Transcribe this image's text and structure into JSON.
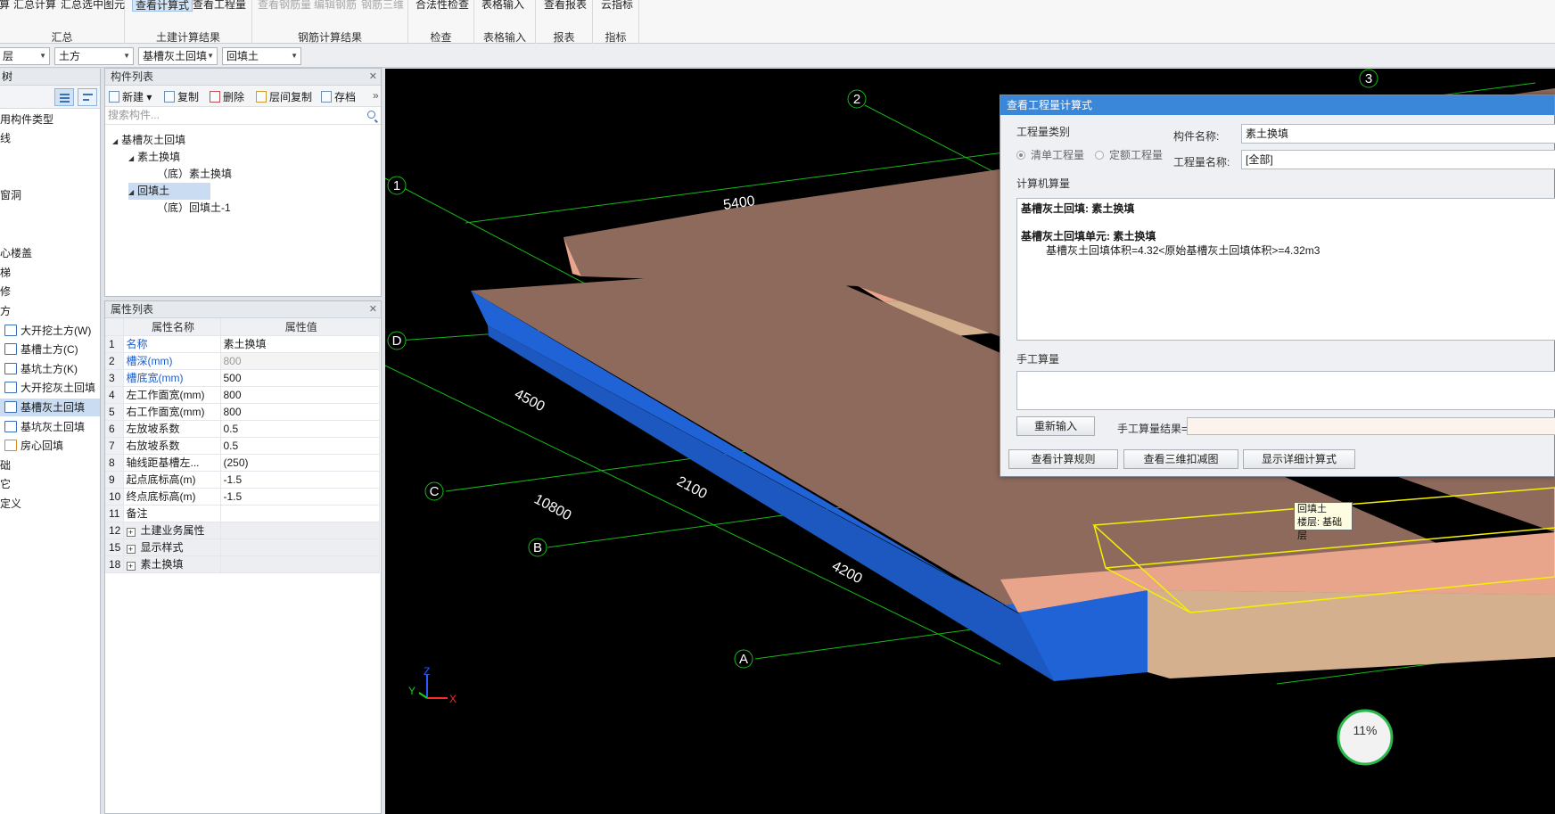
{
  "ribbon": {
    "groups": [
      {
        "label": "汇总",
        "buttons": [
          "算",
          "汇总计算",
          "汇总选中图元"
        ]
      },
      {
        "label": "土建计算结果",
        "buttons": [
          "查看计算式",
          "查看工程量"
        ]
      },
      {
        "label": "钢筋计算结果",
        "buttons": [
          "查看钢筋量",
          "编辑钢筋",
          "钢筋三维"
        ]
      },
      {
        "label": "检查",
        "buttons": [
          "合法性检查"
        ]
      },
      {
        "label": "表格输入",
        "buttons": [
          "表格输入"
        ]
      },
      {
        "label": "报表",
        "buttons": [
          "查看报表"
        ]
      },
      {
        "label": "指标",
        "buttons": [
          "云指标"
        ]
      }
    ]
  },
  "filters": {
    "floor": "层",
    "category": "土方",
    "type": "基槽灰土回填",
    "component": "回填土"
  },
  "leftnav": {
    "header": "树",
    "items": [
      "用构件类型",
      "线",
      "窗洞",
      "心楼盖",
      "梯",
      "修",
      "方",
      "大开挖土方(W)",
      "基槽土方(C)",
      "基坑土方(K)",
      "大开挖灰土回填",
      "基槽灰土回填",
      "基坑灰土回填",
      "房心回填",
      "础",
      "它",
      "定义"
    ]
  },
  "component_list": {
    "title": "构件列表",
    "toolbar": [
      "新建",
      "复制",
      "删除",
      "层间复制",
      "存档"
    ],
    "search_placeholder": "搜索构件...",
    "tree": [
      {
        "label": "基槽灰土回填",
        "level": 0
      },
      {
        "label": "素土换填",
        "level": 1
      },
      {
        "label": "（底）素土换填",
        "level": 2
      },
      {
        "label": "回填土",
        "level": 1
      },
      {
        "label": "（底）回填土-1",
        "level": 2
      }
    ]
  },
  "properties": {
    "title": "属性列表",
    "col_name": "属性名称",
    "col_value": "属性值",
    "rows": [
      {
        "n": "1",
        "name": "名称",
        "value": "素土换填",
        "blue": true
      },
      {
        "n": "2",
        "name": "槽深(mm)",
        "value": "800",
        "blue": true,
        "grey": true
      },
      {
        "n": "3",
        "name": "槽底宽(mm)",
        "value": "500",
        "blue": true
      },
      {
        "n": "4",
        "name": "左工作面宽(mm)",
        "value": "800"
      },
      {
        "n": "5",
        "name": "右工作面宽(mm)",
        "value": "800"
      },
      {
        "n": "6",
        "name": "左放坡系数",
        "value": "0.5"
      },
      {
        "n": "7",
        "name": "右放坡系数",
        "value": "0.5"
      },
      {
        "n": "8",
        "name": "轴线距基槽左...",
        "value": "(250)"
      },
      {
        "n": "9",
        "name": "起点底标高(m)",
        "value": "-1.5"
      },
      {
        "n": "10",
        "name": "终点底标高(m)",
        "value": "-1.5"
      },
      {
        "n": "11",
        "name": "备注",
        "value": ""
      },
      {
        "n": "12",
        "name": "土建业务属性",
        "value": "",
        "group": true
      },
      {
        "n": "15",
        "name": "显示样式",
        "value": "",
        "group": true
      },
      {
        "n": "18",
        "name": "素土换填",
        "value": "",
        "group": true
      }
    ]
  },
  "viewport": {
    "axes": [
      "1",
      "2",
      "3",
      "A",
      "B",
      "C",
      "D"
    ],
    "dims": [
      "5400",
      "4500",
      "2100",
      "10800",
      "4200"
    ],
    "tooltip_line1": "回填土",
    "tooltip_line2": "楼层: 基础层",
    "zoom": "11%",
    "axis_labels": {
      "x": "X",
      "y": "Y",
      "z": "Z"
    }
  },
  "dialog": {
    "title": "查看工程量计算式",
    "qty_category_label": "工程量类别",
    "radio_list": "清单工程量",
    "radio_quota": "定额工程量",
    "comp_name_label": "构件名称:",
    "comp_name_value": "素土换填",
    "qty_name_label": "工程量名称:",
    "qty_name_value": "[全部]",
    "computer_label": "计算机算量",
    "calc_line1": "基槽灰土回填: 素土换填",
    "calc_line2": "基槽灰土回填单元: 素土换填",
    "calc_line3": "基槽灰土回填体积=4.32<原始基槽灰土回填体积>=4.32m3",
    "manual_label": "手工算量",
    "reinput_button": "重新输入",
    "manual_result_label": "手工算量结果=",
    "btn_rules": "查看计算规则",
    "btn_3d": "查看三维扣减图",
    "btn_detail": "显示详细计算式"
  },
  "colors": {
    "accent": "#3a86d8",
    "soil_top": "#8e6a5c",
    "soil_light": "#e8a58c",
    "trench_blue": "#1f63d6",
    "selection_yellow": "#f5f000",
    "grid_green": "#17b917"
  }
}
